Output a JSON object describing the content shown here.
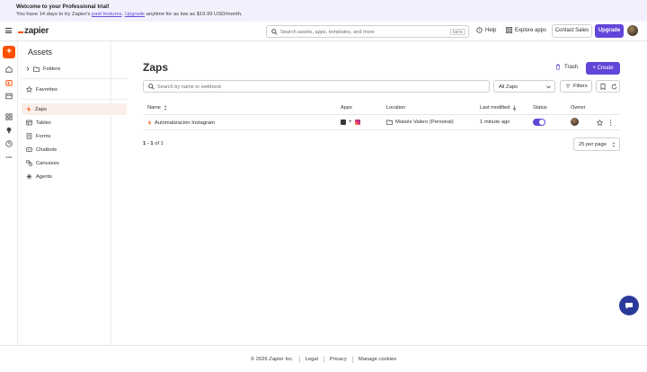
{
  "banner": {
    "title": "Welcome to your Professional trial!",
    "text_before": "You have 14 days to try Zapier's ",
    "link_features": "paid features",
    "text_middle": ". ",
    "link_upgrade": "Upgrade",
    "text_after": " anytime for as low as $19.99 USD/month."
  },
  "topbar": {
    "logo": "zapier",
    "search_placeholder": "Search assets, apps, templates, and more",
    "search_shortcut": "Ctrl K",
    "help": "Help",
    "explore_apps": "Explore apps",
    "contact_sales": "Contact Sales",
    "upgrade": "Upgrade"
  },
  "panel": {
    "title": "Assets",
    "items": [
      {
        "label": "Folders",
        "icon": "folder-icon"
      },
      {
        "label": "Favorites",
        "icon": "star-icon"
      },
      {
        "label": "Zaps",
        "icon": "lightning-icon"
      },
      {
        "label": "Tables",
        "icon": "table-icon"
      },
      {
        "label": "Forms",
        "icon": "form-icon"
      },
      {
        "label": "Chatbots",
        "icon": "chatbot-icon"
      },
      {
        "label": "Canvases",
        "icon": "canvas-icon"
      },
      {
        "label": "Agents",
        "icon": "agent-icon"
      }
    ]
  },
  "main": {
    "title": "Zaps",
    "trash": "Trash",
    "create": "Create",
    "search_placeholder": "Search by name or webhook",
    "filter_select": "All Zaps",
    "filters": "Filters",
    "columns": {
      "name": "Name",
      "apps": "Apps",
      "location": "Location",
      "last_modified": "Last modified",
      "status": "Status",
      "owner": "Owner"
    },
    "rows": [
      {
        "name": "Automatización Instagram",
        "location": "Moisés Valero (Personal)",
        "last_modified": "1 minute ago",
        "status_on": true
      }
    ],
    "pagination": {
      "range": "1 - 1",
      "of": "of 1"
    },
    "per_page": "25 per page"
  },
  "footer": {
    "copyright": "© 2026 Zapier Inc.",
    "legal": "Legal",
    "privacy": "Privacy",
    "manage_cookies": "Manage cookies"
  },
  "colors": {
    "brand_orange": "#ff4f00",
    "accent_purple": "#6246d9",
    "banner_bg": "#f3f0fe",
    "active_item_bg": "#fbeee8"
  }
}
